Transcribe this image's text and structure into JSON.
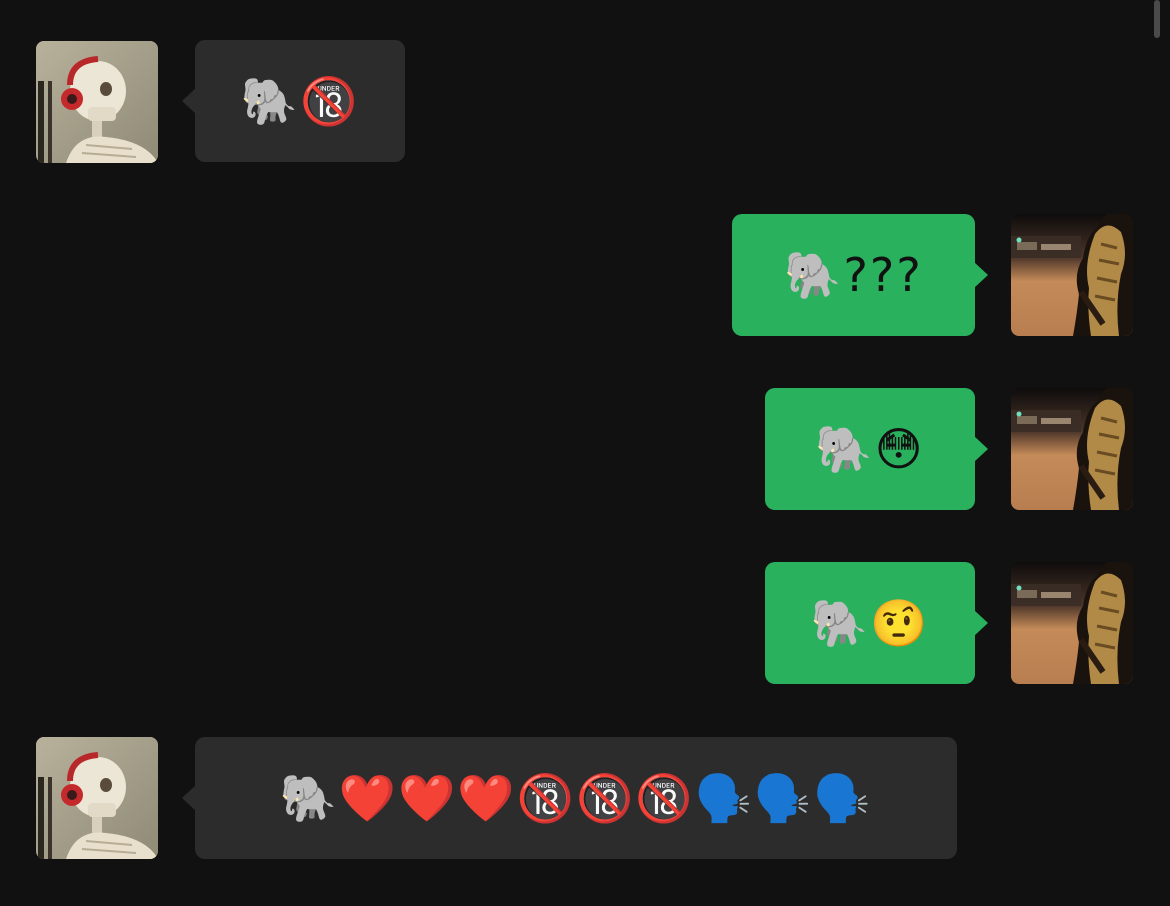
{
  "messages": [
    {
      "sender": "contact",
      "text": "🐘🔞"
    },
    {
      "sender": "self",
      "text": "🐘???"
    },
    {
      "sender": "self",
      "text": "🐘😳"
    },
    {
      "sender": "self",
      "text": "🐘🤨"
    },
    {
      "sender": "contact",
      "text": "🐘❤️❤️❤️🔞🔞🔞🗣️🗣️🗣️"
    }
  ],
  "colors": {
    "background": "#111111",
    "incoming_bubble": "#2c2c2c",
    "outgoing_bubble": "#29b15e"
  },
  "icons": {
    "contact_avatar": "skeleton-with-headphones-avatar",
    "self_avatar": "armored-figure-at-sunset-avatar"
  }
}
